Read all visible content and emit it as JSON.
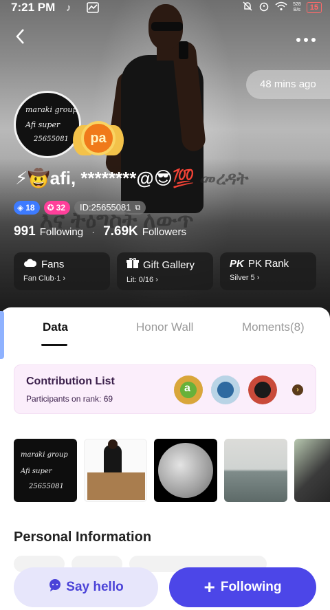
{
  "status_bar": {
    "time": "7:21 PM",
    "net_speed_value": "528",
    "net_speed_unit": "B/s",
    "battery": "15"
  },
  "header": {
    "last_active": "48 mins ago"
  },
  "avatar": {
    "line1": "maraki group",
    "line2": "Afi super",
    "line3": "25655081"
  },
  "badge": {
    "text": "pa"
  },
  "profile": {
    "name_prefix": "⚡🤠afi, ********@😎💯",
    "name_amharic_1": "መረዳት",
    "name_amharic_2": "እና ትዕግስት ለውጥ",
    "level_tag": "18",
    "star_tag": "32",
    "id_label": "ID:25655081",
    "following_count": "991",
    "following_label": "Following",
    "followers_count": "7.69K",
    "followers_label": "Followers"
  },
  "cards": [
    {
      "title": "Fans",
      "sub": "Fan Club·1 ›",
      "icon": "cloud-icon"
    },
    {
      "title": "Gift Gallery",
      "sub": "Lit: 0/16 ›",
      "icon": "gift-icon"
    },
    {
      "title": "PK Rank",
      "sub": "Silver 5 ›",
      "icon": "pk-icon",
      "icon_text": "PK"
    }
  ],
  "tabs": [
    {
      "label": "Data"
    },
    {
      "label": "Honor Wall"
    },
    {
      "label": "Moments(8)"
    }
  ],
  "contribution": {
    "title": "Contribution List",
    "subtitle": "Participants on rank: 69",
    "avatar1_letter": "a"
  },
  "photo1": {
    "line1": "maraki group",
    "line2": "Afi super",
    "line3": "25655081"
  },
  "personal_info": {
    "title": "Personal Information"
  },
  "buttons": {
    "say_hello": "Say hello",
    "following": "Following"
  },
  "colors": {
    "accent": "#4c46e8",
    "accent_light": "#e7e6fb",
    "contribution_bg": "#fbeefb",
    "battery_warning": "#ff6a6a"
  }
}
